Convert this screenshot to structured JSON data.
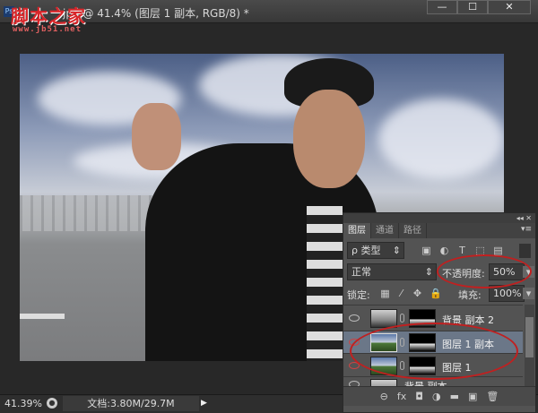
{
  "window": {
    "title": "jpg @ 41.4% (图层 1 副本, RGB/8) *",
    "app_icon": "Ps",
    "minimize": "—",
    "maximize": "☐",
    "close": "✕"
  },
  "watermark": {
    "text": "脚本之家",
    "url": "www.jb51.net"
  },
  "status": {
    "zoom": "41.39%",
    "doc": "文档:3.80M/29.7M",
    "arrow": "▶"
  },
  "panel": {
    "header_icons": "◂◂ ✕",
    "tabs": [
      {
        "label": "图层",
        "active": true
      },
      {
        "label": "通道"
      },
      {
        "label": "路径"
      }
    ],
    "menu_icon": "▾≡",
    "filter": {
      "label": "ρ 类型",
      "arrows": "⇕"
    },
    "blend_mode": "正常",
    "opacity_label": "不透明度:",
    "opacity_value": "50%",
    "lock_label": "锁定:",
    "fill_label": "填充:",
    "fill_value": "100%",
    "layers": [
      {
        "name": "背景 副本 2",
        "visible": true,
        "selected": false
      },
      {
        "name": "图层 1 副本",
        "visible": true,
        "selected": true
      },
      {
        "name": "图层 1",
        "visible": true,
        "selected": false
      },
      {
        "name": "背景 副本",
        "visible": true,
        "selected": false
      }
    ],
    "bottom_tools": [
      "⊖",
      "fx",
      "◘",
      "◑",
      "▬",
      "▣",
      "🗑"
    ]
  },
  "colors": {
    "highlight_ring": "#c02020",
    "selected_layer": "#6b7788"
  }
}
